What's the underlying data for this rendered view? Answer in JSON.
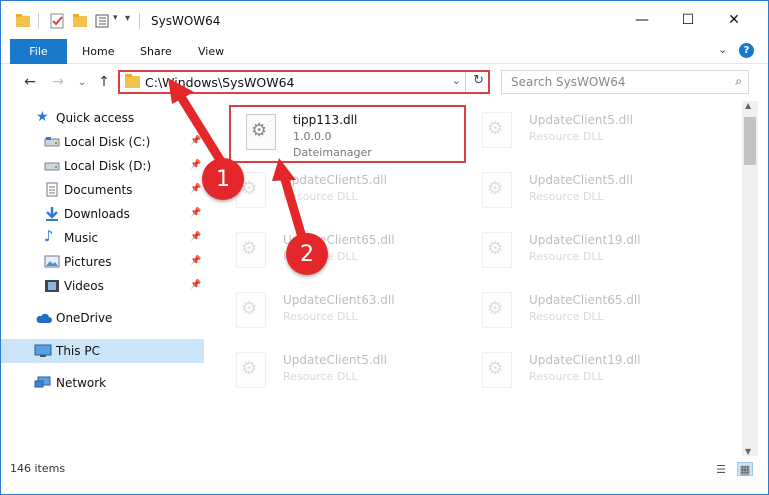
{
  "window": {
    "title": "SysWOW64",
    "controls": {
      "minimize": "—",
      "maximize": "☐",
      "close": "✕"
    }
  },
  "ribbon": {
    "tabs": [
      "File",
      "Home",
      "Share",
      "View"
    ],
    "expand_glyph": "⌄",
    "help_glyph": "?"
  },
  "navigation": {
    "back_glyph": "←",
    "forward_glyph": "→",
    "recent_glyph": "⌄",
    "up_glyph": "↑",
    "address": "C:\\Windows\\SysWOW64",
    "address_chevron": "⌄",
    "refresh_glyph": "↻",
    "search_placeholder": "Search SysWOW64",
    "search_glyph": "⌕"
  },
  "sidebar": {
    "items": [
      {
        "label": "Quick access",
        "icon": "star-icon",
        "pinned": false
      },
      {
        "label": "Local Disk (C:)",
        "icon": "drive-icon",
        "pinned": true
      },
      {
        "label": "Local Disk (D:)",
        "icon": "drive-icon",
        "pinned": true
      },
      {
        "label": "Documents",
        "icon": "documents-icon",
        "pinned": true
      },
      {
        "label": "Downloads",
        "icon": "download-icon",
        "pinned": true
      },
      {
        "label": "Music",
        "icon": "music-icon",
        "pinned": true
      },
      {
        "label": "Pictures",
        "icon": "pictures-icon",
        "pinned": true
      },
      {
        "label": "Videos",
        "icon": "videos-icon",
        "pinned": true
      },
      {
        "label": "OneDrive",
        "icon": "cloud-icon",
        "pinned": false
      },
      {
        "label": "This PC",
        "icon": "computer-icon",
        "pinned": false,
        "selected": true
      },
      {
        "label": "Network",
        "icon": "network-icon",
        "pinned": false
      }
    ],
    "pin_glyph": "📌"
  },
  "files": [
    {
      "name": "tipp113.dll",
      "line1": "1.0.0.0",
      "line2": "Dateimanager",
      "highlighted": true
    },
    {
      "name": "UpdateClient5.dll",
      "line1": "Resource DLL",
      "line2": ""
    },
    {
      "name": "UpdateClient5.dll",
      "line1": "Resource DLL",
      "line2": ""
    },
    {
      "name": "UpdateClient5.dll",
      "line1": "Resource DLL",
      "line2": ""
    },
    {
      "name": "UpdateClient65.dll",
      "line1": "Resource DLL",
      "line2": ""
    },
    {
      "name": "UpdateClient19.dll",
      "line1": "Resource DLL",
      "line2": ""
    },
    {
      "name": "UpdateClient63.dll",
      "line1": "Resource DLL",
      "line2": ""
    },
    {
      "name": "UpdateClient65.dll",
      "line1": "Resource DLL",
      "line2": ""
    },
    {
      "name": "UpdateClient5.dll",
      "line1": "Resource DLL",
      "line2": ""
    },
    {
      "name": "UpdateClient19.dll",
      "line1": "Resource DLL",
      "line2": ""
    }
  ],
  "status": {
    "item_count": "146 items"
  },
  "annotations": {
    "markers": [
      "1",
      "2"
    ],
    "color": "#e3272b"
  },
  "colors": {
    "accent": "#1979ca",
    "selection": "#cce4f7",
    "highlight_border": "#d94043"
  }
}
